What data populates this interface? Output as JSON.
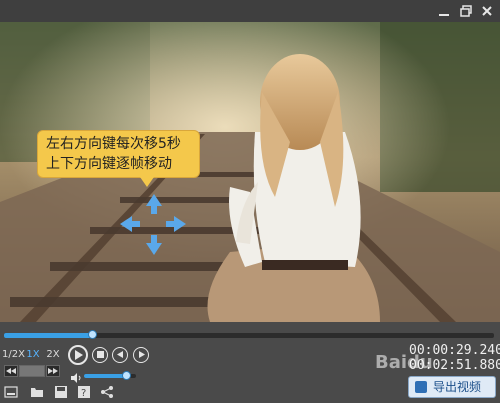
{
  "window": {
    "controls": [
      "minimize-icon",
      "restore-icon",
      "close-icon"
    ]
  },
  "overlay": {
    "tooltip_line1": "左右方向键每次移5秒",
    "tooltip_line2": "上下方向键逐帧移动",
    "tooltip_color": "#f4c84b"
  },
  "player": {
    "seek_progress": 0.18,
    "accent_color": "#3aa0e6",
    "speeds": [
      "1/2X",
      "1X",
      "2X"
    ],
    "active_speed": "1X",
    "current_time": "00:00:29.240",
    "total_time": "00:02:51.880",
    "volume_level": 0.8,
    "play_icon": "play-icon",
    "stop_icon": "stop-icon",
    "prev_icon": "prev-frame-icon",
    "next_icon": "next-frame-icon"
  },
  "toolbar": {
    "export_label": "导出视频"
  },
  "watermark": "Baidu"
}
